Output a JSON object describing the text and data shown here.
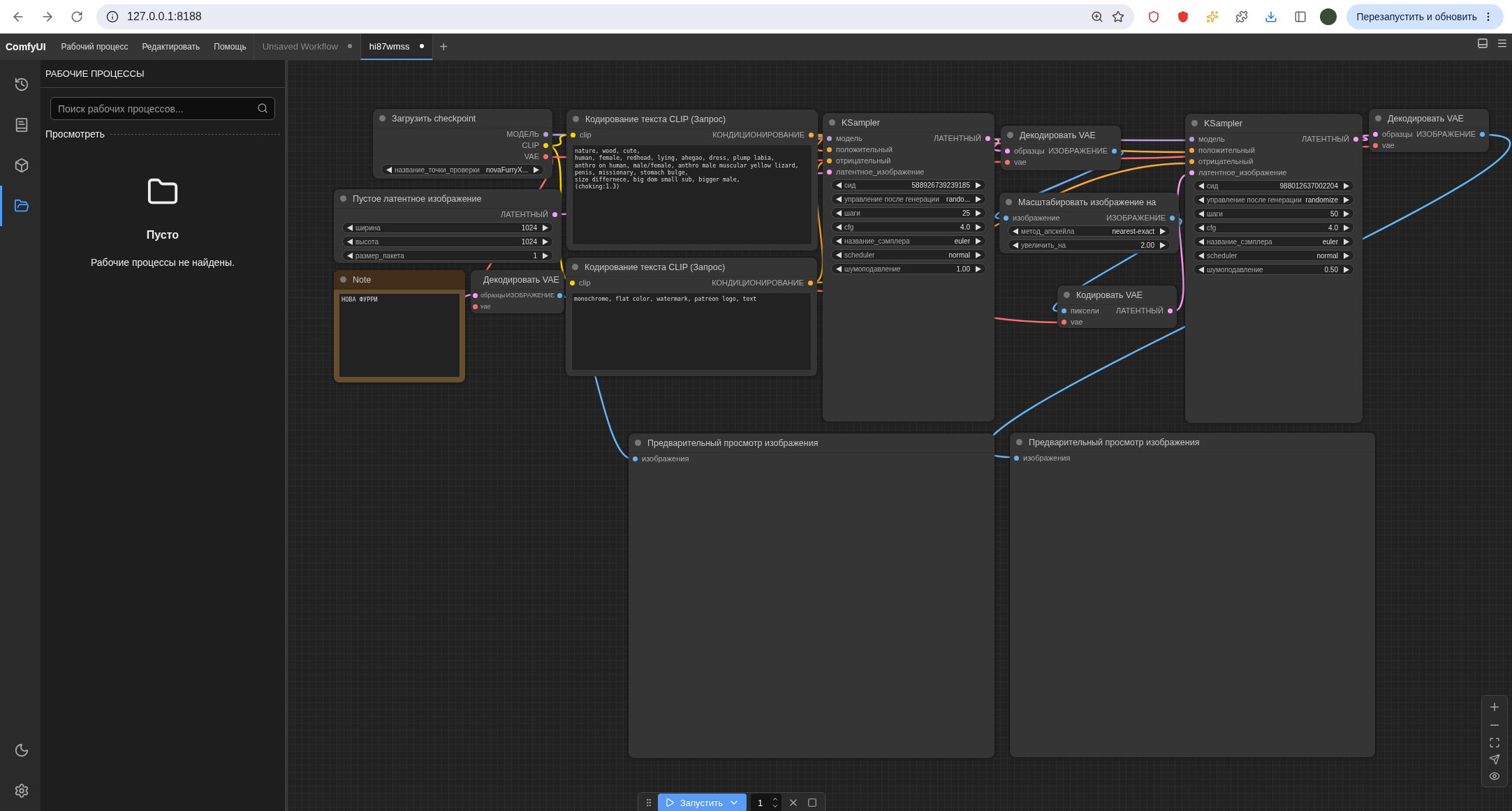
{
  "browser": {
    "address": "127.0.0.1:8188",
    "buttons": [
      "Перезапустить и обновить"
    ]
  },
  "menubar": {
    "logo": "ComfyUI",
    "menus": [
      "Рабочий процесс",
      "Редактировать",
      "Помощь"
    ],
    "tabs": [
      {
        "label": "Unsaved Workflow",
        "selected": false,
        "unsaved": true
      },
      {
        "label": "hi87wmss",
        "selected": true,
        "unsaved": true
      }
    ],
    "new_tab": "+"
  },
  "sidebar": {
    "nav": [
      {
        "selected": false
      },
      {
        "selected": false
      },
      {
        "selected": false
      },
      {
        "selected": true
      }
    ],
    "panel": {
      "title": "РАБОЧИЕ ПРОЦЕССЫ",
      "search": {
        "placeholder": "Поиск рабочих процессов..."
      },
      "section": "Просмотреть",
      "empty_title": "Пусто",
      "empty_message": "Рабочие процессы не найдены."
    }
  },
  "canvas": {
    "nodes": [
      {
        "kind": "standard",
        "title": "Загрузить checkpoint",
        "outputs": [
          {
            "label": "МОДЕЛЬ",
            "color": "#b39ddb"
          },
          {
            "label": "CLIP",
            "color": "#ffd500"
          },
          {
            "label": "VAE",
            "color": "#ff6e6e"
          }
        ],
        "widgets": [
          {
            "label": "название_точки_проверки",
            "value": "novaFurryX..."
          }
        ]
      },
      {
        "kind": "standard",
        "title": "Пустое латентное изображение",
        "outputs": [
          {
            "label": "ЛАТЕНТНЫЙ",
            "color": "#ff9cf9"
          }
        ],
        "widgets": [
          {
            "label": "ширина",
            "value": "1024"
          },
          {
            "label": "высота",
            "value": "1024"
          },
          {
            "label": "размер_пакета",
            "value": "1"
          }
        ]
      },
      {
        "kind": "note",
        "title": "Note",
        "text": "НОВА ФУРРИ"
      },
      {
        "kind": "standard",
        "title": "Декодировать VAE",
        "inputs": [
          {
            "label": "образцы",
            "color": "#ff9cf9"
          },
          {
            "label": "vae",
            "color": "#ff6e6e"
          }
        ],
        "outputs": [
          {
            "label": "ИЗОБРАЖЕНИЕ",
            "color": "#64b5f6"
          }
        ]
      },
      {
        "kind": "prompt",
        "title": "Кодирование текста CLIP (Запрос)",
        "inputs": [
          {
            "label": "clip",
            "color": "#ffd500"
          }
        ],
        "outputs": [
          {
            "label": "КОНДИЦИОНИРОВАНИЕ",
            "color": "#ffa931"
          }
        ],
        "text": "nature, wood, cute,\nhuman, female, redhead, lying, ahegao, dress, plump labia,\nanthro on human, male/female, anthro male muscular yellow lizard,\npenis, missionary, stomach bulge,\nsize differnece, big dom small sub, bigger male,\n(choking:1.3)"
      },
      {
        "kind": "prompt",
        "title": "Кодирование текста CLIP (Запрос)",
        "inputs": [
          {
            "label": "clip",
            "color": "#ffd500"
          }
        ],
        "outputs": [
          {
            "label": "КОНДИЦИОНИРОВАНИЕ",
            "color": "#ffa931"
          }
        ],
        "text": "monochrome, flat color, watermark, patreon logo, text"
      },
      {
        "kind": "standard",
        "title": "KSampler",
        "inputs": [
          {
            "label": "модель",
            "color": "#b39ddb"
          },
          {
            "label": "положительный",
            "color": "#ffa931"
          },
          {
            "label": "отрицательный",
            "color": "#ffa931"
          },
          {
            "label": "латентное_изображение",
            "color": "#ff9cf9"
          }
        ],
        "outputs": [
          {
            "label": "ЛАТЕНТНЫЙ",
            "color": "#ff9cf9"
          }
        ],
        "widgets": [
          {
            "label": "сид",
            "value": "588926739239185"
          },
          {
            "label": "управление после генерации",
            "value": "rando..."
          },
          {
            "label": "шаги",
            "value": "25"
          },
          {
            "label": "cfg",
            "value": "4.0"
          },
          {
            "label": "название_сэмплера",
            "value": "euler"
          },
          {
            "label": "scheduler",
            "value": "normal"
          },
          {
            "label": "шумоподавление",
            "value": "1.00"
          }
        ]
      },
      {
        "kind": "standard",
        "title": "Декодировать VAE",
        "inputs": [
          {
            "label": "образцы",
            "color": "#ff9cf9"
          },
          {
            "label": "vae",
            "color": "#ff6e6e"
          }
        ],
        "outputs": [
          {
            "label": "ИЗОБРАЖЕНИЕ",
            "color": "#64b5f6"
          }
        ]
      },
      {
        "kind": "standard",
        "title": "Масштабировать изображение на",
        "inputs": [
          {
            "label": "изображение",
            "color": "#64b5f6"
          }
        ],
        "outputs": [
          {
            "label": "ИЗОБРАЖЕНИЕ",
            "color": "#64b5f6"
          }
        ],
        "widgets": [
          {
            "label": "метод_апскейла",
            "value": "nearest-exact"
          },
          {
            "label": "увеличить_на",
            "value": "2.00"
          }
        ]
      },
      {
        "kind": "standard",
        "title": "Кодировать VAE",
        "inputs": [
          {
            "label": "пиксели",
            "color": "#64b5f6"
          },
          {
            "label": "vae",
            "color": "#ff6e6e"
          }
        ],
        "outputs": [
          {
            "label": "ЛАТЕНТНЫЙ",
            "color": "#ff9cf9"
          }
        ]
      },
      {
        "kind": "standard",
        "title": "KSampler",
        "inputs": [
          {
            "label": "модель",
            "color": "#b39ddb"
          },
          {
            "label": "положительный",
            "color": "#ffa931"
          },
          {
            "label": "отрицательный",
            "color": "#ffa931"
          },
          {
            "label": "латентное_изображение",
            "color": "#ff9cf9"
          }
        ],
        "outputs": [
          {
            "label": "ЛАТЕНТНЫЙ",
            "color": "#ff9cf9"
          }
        ],
        "widgets": [
          {
            "label": "сид",
            "value": "988012637002204"
          },
          {
            "label": "управление после генерации",
            "value": "randomize"
          },
          {
            "label": "шаги",
            "value": "50"
          },
          {
            "label": "cfg",
            "value": "4.0"
          },
          {
            "label": "название_сэмплера",
            "value": "euler"
          },
          {
            "label": "scheduler",
            "value": "normal"
          },
          {
            "label": "шумоподавление",
            "value": "0.50"
          }
        ]
      },
      {
        "kind": "standard",
        "title": "Декодировать VAE",
        "inputs": [
          {
            "label": "образцы",
            "color": "#ff9cf9"
          },
          {
            "label": "vae",
            "color": "#ff6e6e"
          }
        ],
        "outputs": [
          {
            "label": "ИЗОБРАЖЕНИЕ",
            "color": "#64b5f6"
          }
        ]
      },
      {
        "kind": "standard",
        "title": "Предварительный просмотр изображения",
        "inputs": [
          {
            "label": "изображения",
            "color": "#64b5f6"
          }
        ]
      },
      {
        "kind": "standard",
        "title": "Предварительный просмотр изображения",
        "inputs": [
          {
            "label": "изображения",
            "color": "#64b5f6"
          }
        ]
      }
    ]
  },
  "queue": {
    "run_label": "Запустить",
    "count": "1"
  }
}
